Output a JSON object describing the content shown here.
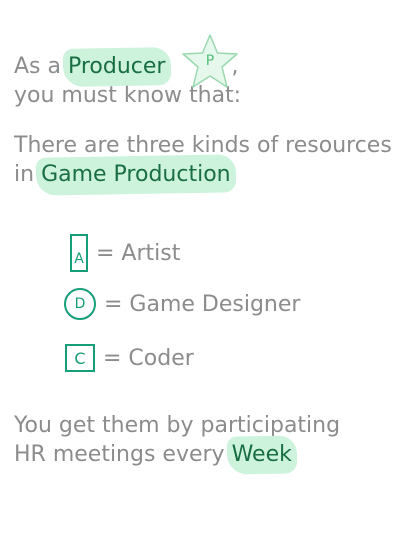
{
  "intro": {
    "prefix": "As a ",
    "role": "Producer",
    "star_letter": "P",
    "after_star": ",",
    "line2": "you must know that:"
  },
  "resources": {
    "line1": "There are three kinds of resources",
    "prefix": "in ",
    "highlight": "Game Production",
    "suffix": "."
  },
  "legend": [
    {
      "letter": "A",
      "label": "= Artist"
    },
    {
      "letter": "D",
      "label": "= Game Designer"
    },
    {
      "letter": "C",
      "label": "= Coder"
    }
  ],
  "outro": {
    "line1": "You get them by participating",
    "prefix": "HR meetings every ",
    "highlight": "Week",
    "suffix": "."
  },
  "colors": {
    "text": "#8c8c8c",
    "highlight_text": "#1a6e44",
    "highlight_bg": "#cdf3dc",
    "icon": "#159e78",
    "star": "#9ad8b0"
  }
}
